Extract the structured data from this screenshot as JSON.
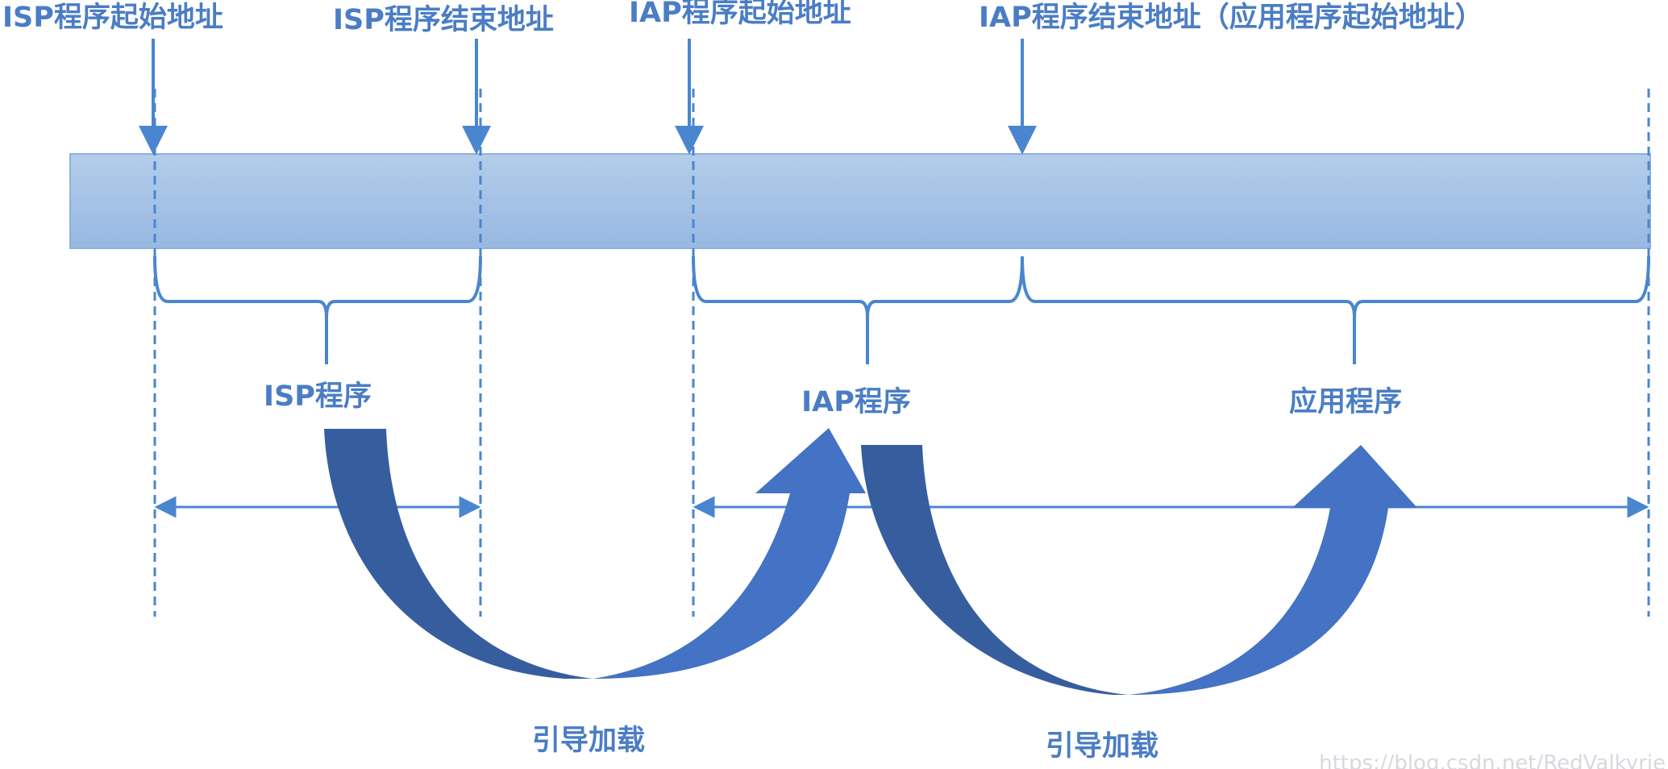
{
  "addresses": {
    "isp_start": "ISP程序起始地址",
    "isp_end": "ISP程序结束地址",
    "iap_start": "IAP程序起始地址",
    "iap_end": "IAP程序结束地址（应用程序起始地址）"
  },
  "segments": {
    "isp": "ISP程序",
    "iap": "IAP程序",
    "app": "应用程序"
  },
  "boot": {
    "first": "引导加载",
    "second": "引导加载"
  },
  "watermark": "https://blog.csdn.net/RedValkyrie",
  "colors": {
    "line": "#4a86d0",
    "text": "#4a7dc4",
    "memory_bar_top": "#b3cdea",
    "memory_bar_bottom": "#98b8e2",
    "arrow_dark": "#365e9f",
    "arrow_light": "#4472c4"
  }
}
